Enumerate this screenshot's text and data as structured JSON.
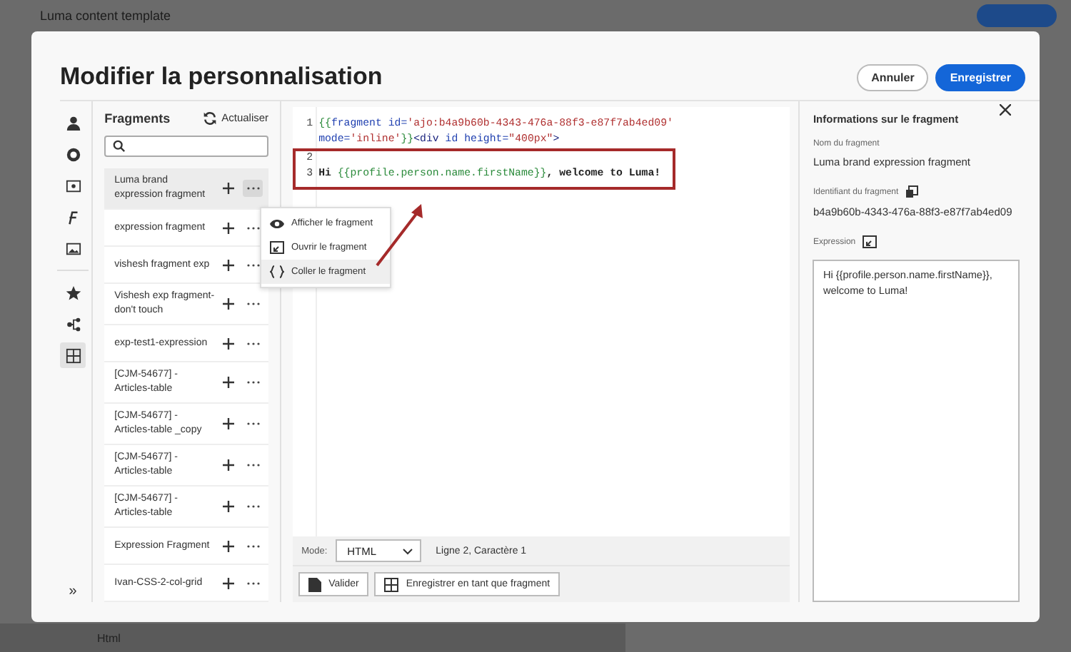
{
  "background": {
    "title": "Luma content template",
    "bottom_bar_label": "Html"
  },
  "dialog": {
    "title": "Modifier la personnalisation",
    "buttons": [
      {
        "label": "Annuler",
        "kind": "secondary"
      },
      {
        "label": "Enregistrer",
        "kind": "primary"
      }
    ]
  },
  "rail": [
    {
      "kind": "person",
      "selected": false
    },
    {
      "kind": "target",
      "selected": false
    },
    {
      "kind": "square",
      "selected": false
    },
    {
      "kind": "function",
      "selected": false
    },
    {
      "kind": "image",
      "selected": false
    },
    {
      "kind": "star",
      "selected": false
    },
    {
      "kind": "tree",
      "selected": false
    },
    {
      "kind": "fragment",
      "selected": true
    }
  ],
  "rail_collapse": "»",
  "fragments": {
    "title": "Fragments",
    "refresh": "Actualiser",
    "items": [
      {
        "name": "Luma brand expression fragment",
        "selected": true
      },
      {
        "name": "expression fragment",
        "selected": false
      },
      {
        "name": "vishesh fragment exp",
        "selected": false
      },
      {
        "name": "Vishesh exp fragment-don't touch",
        "selected": false
      },
      {
        "name": "exp-test1-expression",
        "selected": false
      },
      {
        "name": "[CJM-54677] - Articles-table",
        "selected": false
      },
      {
        "name": "[CJM-54677] - Articles-table _copy",
        "selected": false
      },
      {
        "name": "[CJM-54677] - Articles-table",
        "selected": false
      },
      {
        "name": "[CJM-54677] - Articles-table",
        "selected": false
      },
      {
        "name": "Expression Fragment",
        "selected": false
      },
      {
        "name": "Ivan-CSS-2-col-grid",
        "selected": false
      }
    ]
  },
  "context_menu": [
    {
      "label": "Afficher le fragment",
      "kind": "eye",
      "selected": false
    },
    {
      "label": "Ouvrir le fragment",
      "kind": "open",
      "selected": false
    },
    {
      "label": "Coller le fragment",
      "kind": "braces",
      "selected": true
    }
  ],
  "editor": {
    "lines": [
      {
        "number": "1",
        "highlighted": false,
        "rows": [
          [
            {
              "kind": "punct",
              "text": "{{"
            },
            {
              "kind": "keyword",
              "text": "fragment id="
            },
            {
              "kind": "string",
              "text": "'ajo:b4a9b60b-4343-476a-88f3-e87f7ab4ed09'"
            }
          ],
          [
            {
              "kind": "keyword",
              "text": "mode="
            },
            {
              "kind": "string",
              "text": "'inline'"
            },
            {
              "kind": "punct",
              "text": "}}"
            },
            {
              "kind": "tag",
              "text": "<div"
            },
            {
              "kind": "keyword",
              "text": " id height="
            },
            {
              "kind": "string",
              "text": "\"400px\""
            },
            {
              "kind": "tag",
              "text": ">"
            }
          ]
        ]
      },
      {
        "number": "2",
        "highlighted": true,
        "rows": [
          []
        ]
      },
      {
        "number": "3",
        "highlighted": true,
        "rows": [
          [
            {
              "kind": "text",
              "text": "Hi "
            },
            {
              "kind": "punct",
              "text": "{{profile.person.name.firstName}}"
            },
            {
              "kind": "text",
              "text": ", welcome to Luma!"
            }
          ]
        ]
      }
    ],
    "mode_label": "Mode:",
    "mode": "HTML",
    "cursor": "Ligne 2, Caractère 1",
    "buttons": [
      {
        "label": "Valider",
        "kind": "validate"
      },
      {
        "label": "Enregistrer en tant que fragment",
        "kind": "save"
      }
    ]
  },
  "info": {
    "title": "Informations sur le fragment",
    "name_label": "Nom du fragment",
    "name": "Luma brand expression fragment",
    "id_label": "Identifiant du fragment",
    "id": "b4a9b60b-4343-476a-88f3-e87f7ab4ed09",
    "expression_label": "Expression",
    "expression": "Hi {{profile.person.name.firstName}}, welcome to Luma!"
  }
}
